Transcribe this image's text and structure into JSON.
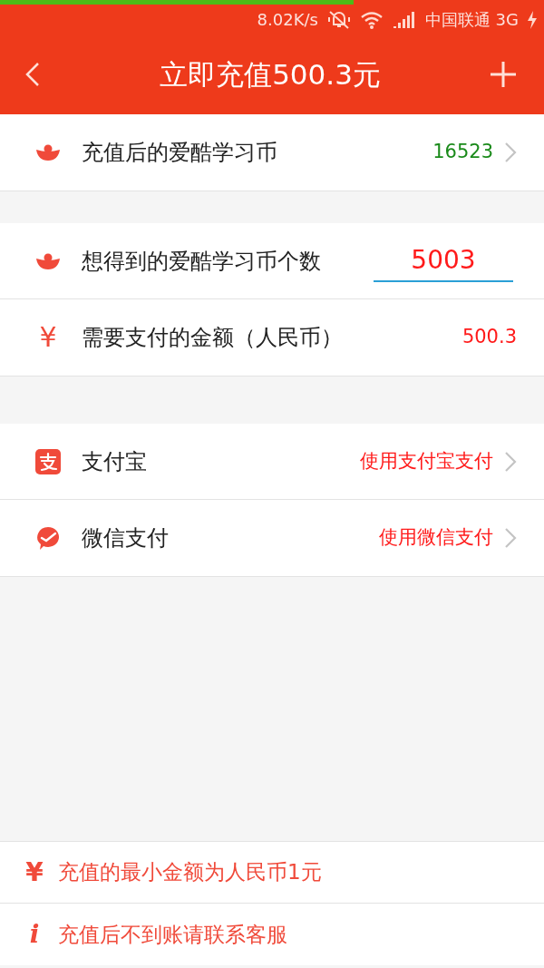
{
  "load_bar": {
    "level": 0.65
  },
  "status_bar": {
    "speed": "8.02K/s",
    "carrier": "中国联通 3G"
  },
  "header": {
    "title": "立即充值500.3元"
  },
  "sections": [
    {
      "rows": [
        {
          "kind": "link",
          "label": "充值后的爱酷学习币",
          "value": "16523"
        }
      ]
    },
    {
      "rows": [
        {
          "kind": "input",
          "label": "想得到的爱酷学习币个数",
          "value": "5003"
        },
        {
          "kind": "amount",
          "icon_text": "¥",
          "label": "需要支付的金额（人民币）",
          "value": "500.3"
        }
      ]
    },
    {
      "rows": [
        {
          "kind": "link",
          "label": "支付宝",
          "value": "使用支付宝支付"
        },
        {
          "kind": "link",
          "label": "微信支付",
          "value": "使用微信支付"
        }
      ]
    }
  ],
  "notes": [
    {
      "icon": "¥",
      "text": "充值的最小金额为人民币1元"
    },
    {
      "icon": "i",
      "text": "充值后不到账请联系客服"
    }
  ]
}
